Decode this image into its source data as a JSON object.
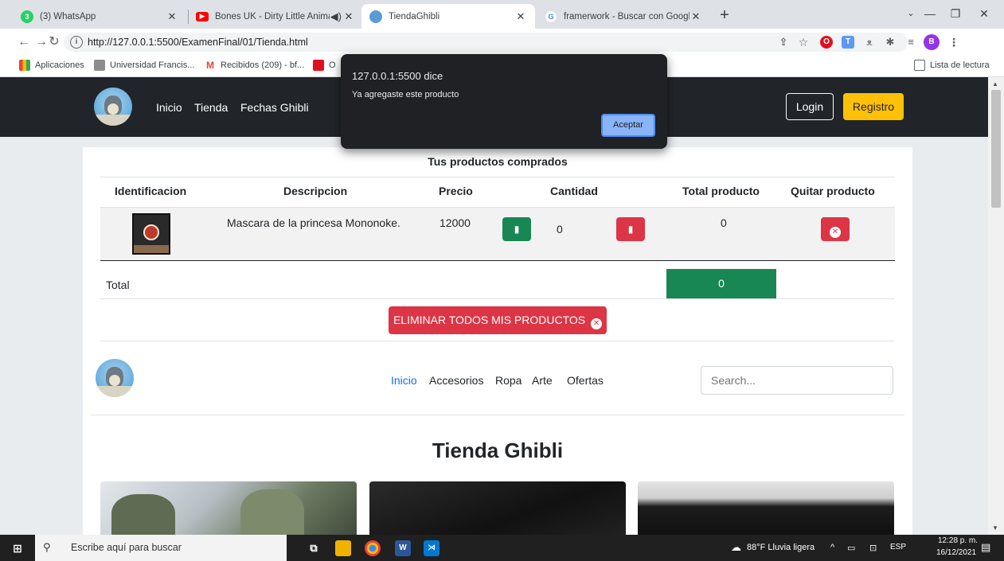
{
  "browser": {
    "tabs": [
      {
        "title": "(3) WhatsApp",
        "icon": "whatsapp-icon",
        "badge": "3"
      },
      {
        "title": "Bones UK - Dirty Little Anima",
        "icon": "youtube-icon"
      },
      {
        "title": "TiendaGhibli",
        "icon": "totoro-favicon",
        "active": true
      },
      {
        "title": "framerwork - Buscar con Google",
        "icon": "google-icon",
        "favicon_letter": "G"
      }
    ],
    "new_tab": "+",
    "url": "http://127.0.0.1:5500/ExamenFinal/01/Tienda.html",
    "profile_initial": "B",
    "bookmarks": [
      {
        "label": "Aplicaciones",
        "icon": "apps-grid-icon"
      },
      {
        "label": "Universidad Francis...",
        "icon": "university-icon"
      },
      {
        "label": "Recibidos (209) - bf...",
        "icon": "gmail-icon",
        "icon_letter": "M"
      },
      {
        "label": "O",
        "icon": "opera-icon"
      }
    ],
    "reading_list": "Lista de lectura"
  },
  "dialog": {
    "origin": "127.0.0.1:5500 dice",
    "message": "Ya agregaste este producto",
    "ok": "Aceptar"
  },
  "site_nav": {
    "links": [
      "Inicio",
      "Tienda",
      "Fechas Ghibli"
    ],
    "login": "Login",
    "register": "Registro"
  },
  "cart": {
    "caption": "Tus productos comprados",
    "headers": [
      "Identificacion",
      "Descripcion",
      "Precio",
      "Cantidad",
      "Total producto",
      "Quitar producto"
    ],
    "rows": [
      {
        "description": "Mascara de la princesa Mononoke.",
        "price": "12000",
        "quantity": "0",
        "total": "0"
      }
    ],
    "total_label": "Total",
    "total_value": "0",
    "clear_button": "ELIMINAR TODOS MIS PRODUCTOS",
    "bookmark_glyph": "▮",
    "remove_glyph": "✕"
  },
  "shop_nav": {
    "links": [
      "Inicio",
      "Accesorios",
      "Ropa",
      "Arte",
      "Ofertas"
    ],
    "active": "Inicio",
    "search_placeholder": "Search..."
  },
  "shop": {
    "title": "Tienda Ghibli"
  },
  "taskbar": {
    "search_placeholder": "Escribe aquí para buscar",
    "weather": "88°F  Lluvia ligera",
    "lang": "ESP",
    "time": "12:28 p. m.",
    "date": "16/12/2021"
  },
  "colors": {
    "navbar": "#212529",
    "warning": "#ffc107",
    "success": "#198754",
    "danger": "#dc3545",
    "link_active": "#0d6efd"
  }
}
